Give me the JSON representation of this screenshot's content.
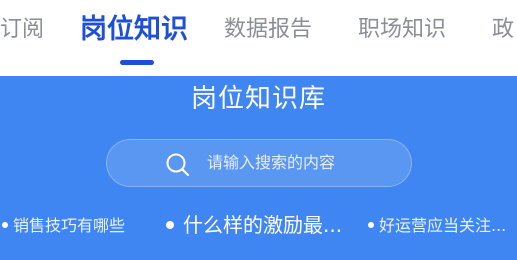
{
  "tabs": [
    {
      "label": "订阅"
    },
    {
      "label": "岗位知识",
      "active": true
    },
    {
      "label": "数据报告"
    },
    {
      "label": "职场知识"
    },
    {
      "label": "政"
    }
  ],
  "colors": {
    "accent": "#1d4fd8",
    "tab_inactive": "#8a8e96",
    "panel_background": "#3f86f2"
  },
  "knowledge_panel": {
    "title": "岗位知识库",
    "search": {
      "placeholder": "请输入搜索的内容",
      "icon": "search-icon"
    },
    "hot_topics": [
      {
        "label": "销售技巧有哪些"
      },
      {
        "label": "什么样的激励最..."
      },
      {
        "label": "好运营应当关注..."
      }
    ]
  }
}
